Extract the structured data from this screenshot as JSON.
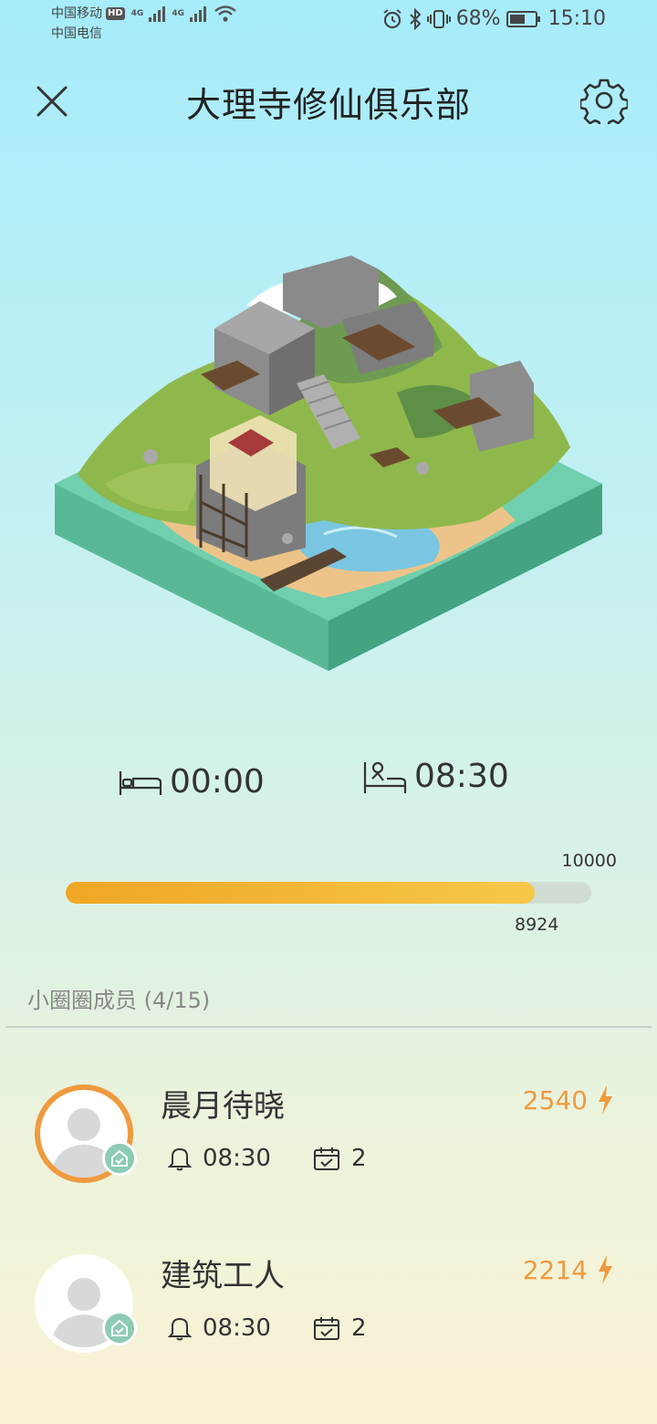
{
  "status": {
    "carrier1": "中国移动",
    "hd": "HD",
    "net1": "4G",
    "net2": "4G",
    "carrier2": "中国电信",
    "battery_pct": "68%",
    "battery_level": 0.68,
    "time": "15:10"
  },
  "header": {
    "title": "大理寺修仙俱乐部"
  },
  "sleep": {
    "bed_time": "00:00",
    "wake_time": "08:30"
  },
  "progress": {
    "max_label": "10000",
    "value_label": "8924",
    "fraction": 0.8924
  },
  "members": {
    "title": "小圈圈成员 (4/15)",
    "list": [
      {
        "name": "晨月待晓",
        "score": "2540",
        "alarm": "08:30",
        "days": "2"
      },
      {
        "name": "建筑工人",
        "score": "2214",
        "alarm": "08:30",
        "days": "2"
      }
    ]
  },
  "colors": {
    "accent": "#ef9a3f",
    "progress_start": "#f0a624",
    "progress_end": "#f6c84a",
    "badge": "#8ccbb4"
  }
}
